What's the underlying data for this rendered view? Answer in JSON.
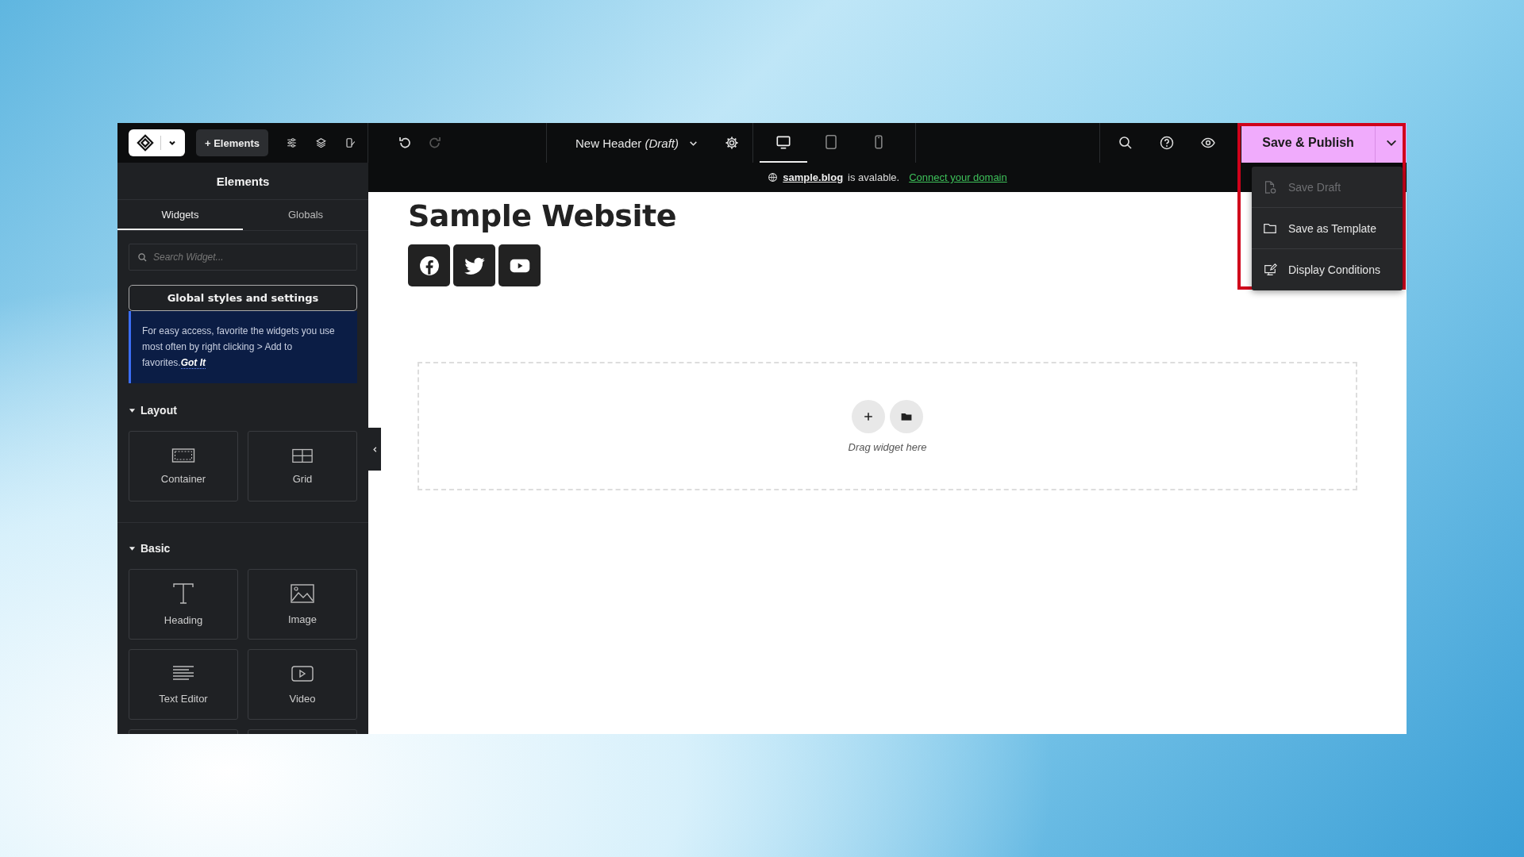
{
  "toolbar": {
    "add_button": "+ Elements",
    "tools": [
      {
        "kind": "sliders"
      },
      {
        "kind": "layers"
      },
      {
        "kind": "theme"
      }
    ],
    "history": [
      {
        "kind": "undo",
        "disabled": false
      },
      {
        "kind": "redo",
        "disabled": true
      }
    ],
    "document_title": "New Header *(Draft)*",
    "devices": [
      {
        "kind": "desktop",
        "selected": true
      },
      {
        "kind": "tablet",
        "selected": false
      },
      {
        "kind": "mobile",
        "selected": false
      }
    ],
    "publish_button": "Save & Publish"
  },
  "publish_menu": [
    {
      "kind": "draft",
      "label": "Save Draft",
      "disabled": true
    },
    {
      "kind": "template",
      "label": "Save as Template",
      "disabled": false
    },
    {
      "kind": "conditions",
      "label": "Display Conditions",
      "disabled": false
    }
  ],
  "notice": {
    "domain": "sample.blog",
    "text": "is avalable.",
    "link": "Connect your domain"
  },
  "sidebar": {
    "title": "Elements",
    "tabs": [
      {
        "label": "Widgets",
        "selected": true
      },
      {
        "label": "Globals",
        "selected": false
      }
    ],
    "search": {
      "placeholder": "Search Widget..."
    },
    "global_button": "Global styles and settings",
    "tip": {
      "text": "For easy access, favorite the widgets you use most often by right clicking > Add to favorites.",
      "link": "Got It"
    },
    "categories": [
      {
        "title": "Layout",
        "expanded": true,
        "widgets": [
          {
            "kind": "container",
            "label": "Container"
          },
          {
            "kind": "grid",
            "label": "Grid"
          }
        ]
      },
      {
        "title": "Basic",
        "expanded": true,
        "widgets": [
          {
            "kind": "heading",
            "label": "Heading"
          },
          {
            "kind": "image",
            "label": "Image"
          },
          {
            "kind": "text",
            "label": "Text Editor"
          },
          {
            "kind": "video",
            "label": "Video"
          }
        ]
      }
    ]
  },
  "canvas": {
    "site_title": "Sample Website",
    "social": [
      {
        "kind": "facebook"
      },
      {
        "kind": "twitter"
      },
      {
        "kind": "youtube"
      }
    ],
    "drop_zone": "Drag widget here"
  }
}
